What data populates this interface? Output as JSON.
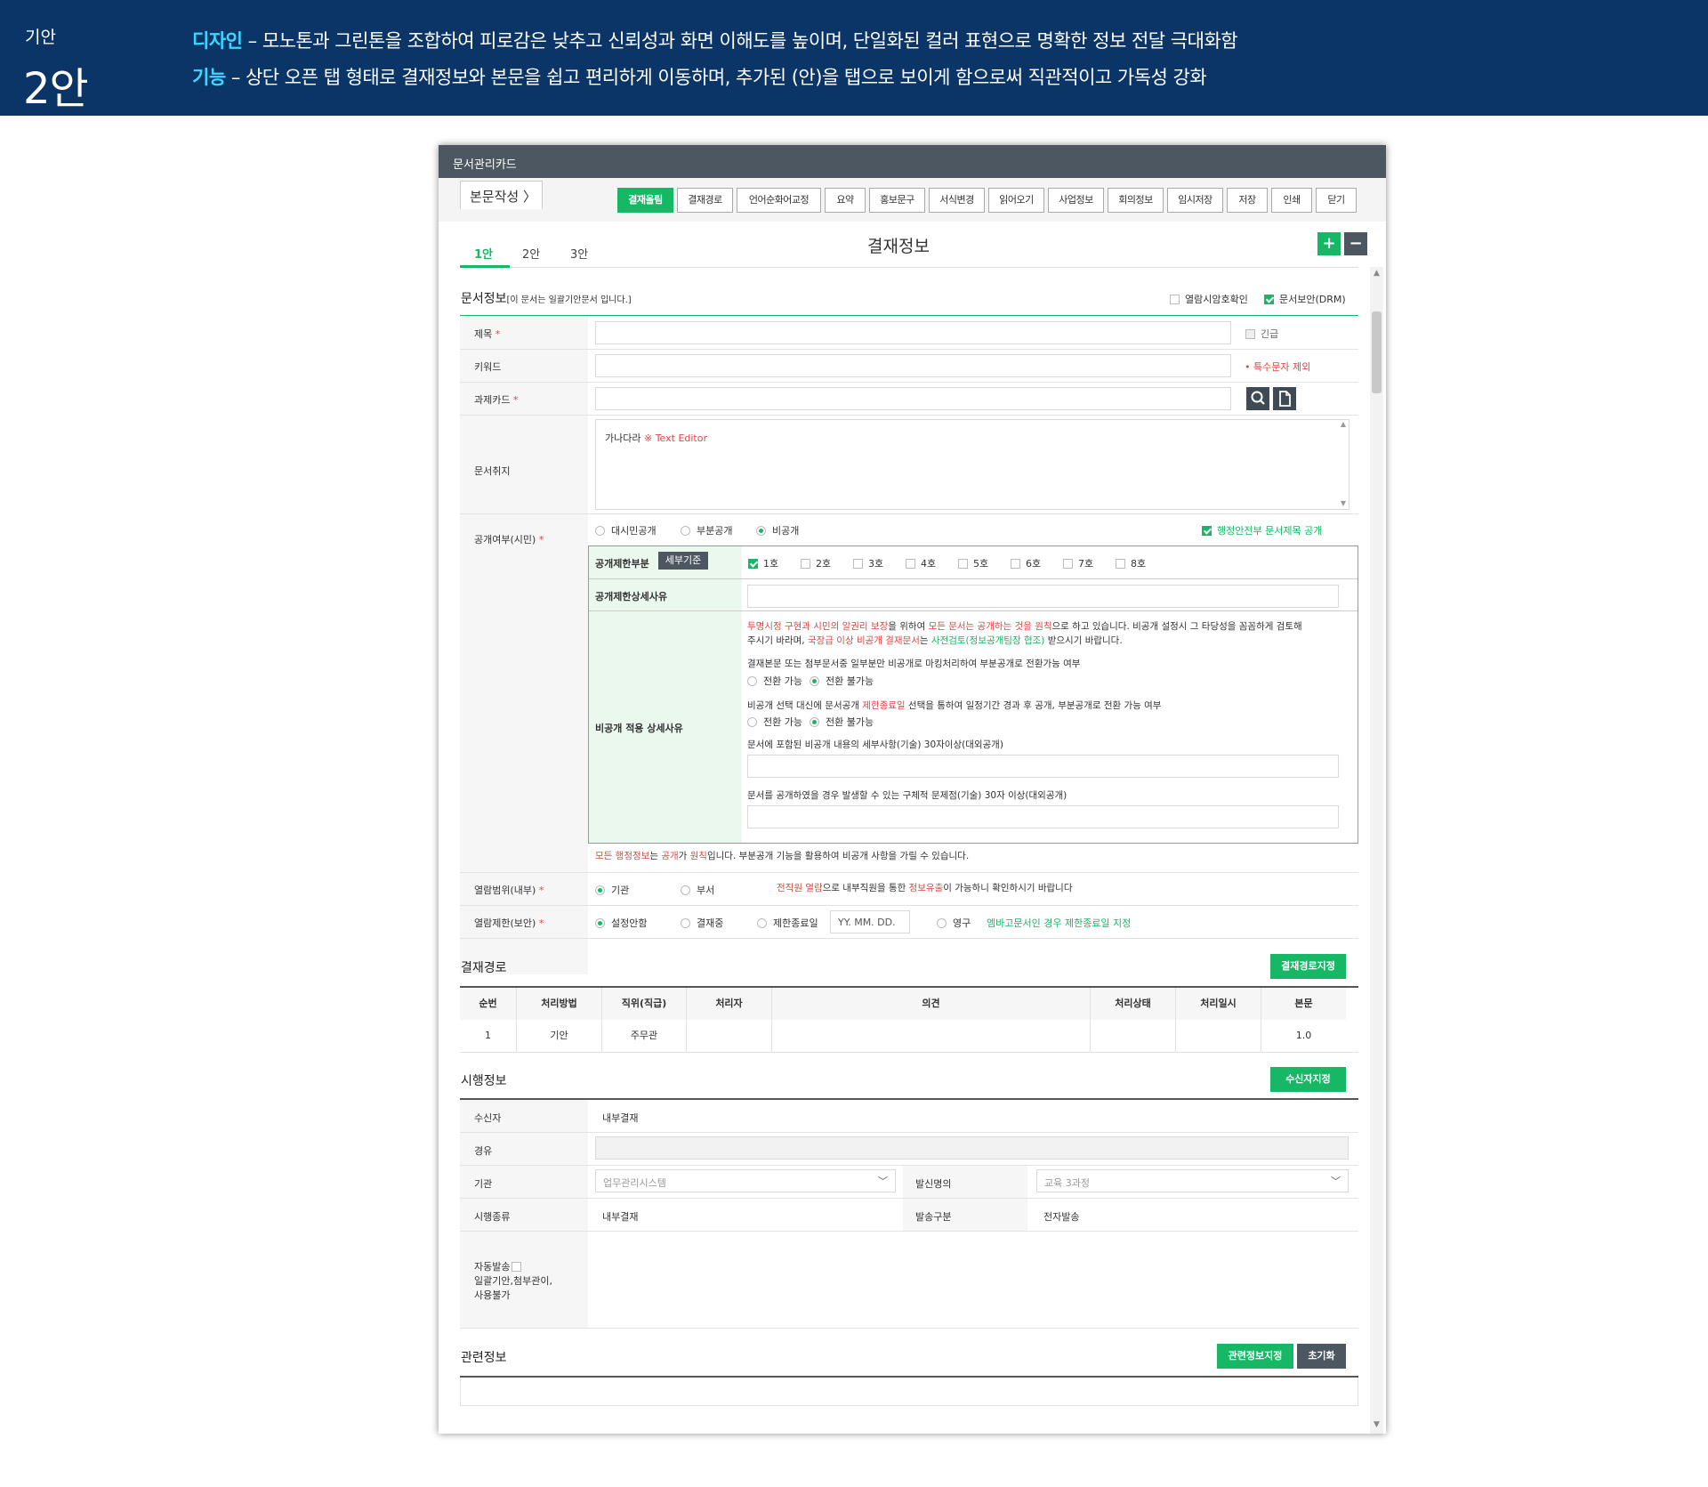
{
  "banner": {
    "kian": "기안",
    "num": "2안",
    "line1_key": "디자인",
    "line1_text": " – 모노톤과 그린톤을 조합하여 피로감은 낮추고 신뢰성과 화면 이해도를 높이며, 단일화된 컬러 표현으로 명확한 정보 전달 극대화함",
    "line2_key": "기능",
    "line2_text": " – 상단 오픈 탭 형태로 결재정보와 본문을 쉽고 편리하게 이동하며, 추가된 (안)을 탭으로 보이게 함으로써 직관적이고 가독성 강화"
  },
  "window": {
    "title": "문서관리카드",
    "body_tab": "본문작성 〉",
    "toolbar": [
      "결재올림",
      "결재경로",
      "언어순화어교정",
      "요약",
      "홍보문구",
      "서식변경",
      "읽어오기",
      "사업정보",
      "회의정보",
      "임시저장",
      "저장",
      "인쇄",
      "닫기"
    ],
    "page_title": "결재정보",
    "plus": "+",
    "minus": "−",
    "tabs": [
      "1안",
      "2안",
      "3안"
    ]
  },
  "docinfo": {
    "title": "문서정보",
    "sub": "[이 문서는 일괄기안문서 입니다.]",
    "cb_verify": "열람시암호확인",
    "cb_drm": "문서보안(DRM)",
    "f_title": "제목",
    "star": "*",
    "urgent": "긴급",
    "f_keyword": "키워드",
    "kw_note": "• 특수문자 제외",
    "f_taskcard": "과제카드",
    "f_purpose": "문서취지",
    "editor_text": "가나다라",
    "editor_hint": "※ Text Editor",
    "f_public": "공개여부(시민)",
    "r_public": "대시민공개",
    "r_partial": "부분공개",
    "r_private": "비공개",
    "cb_gov": "행정안전부 문서제목 공개",
    "limit_part": "공개제한부분",
    "detail_btn": "세부기준",
    "numbers": [
      "1호",
      "2호",
      "3호",
      "4호",
      "5호",
      "6호",
      "7호",
      "8호"
    ],
    "limit_reason": "공개제한상세사유",
    "private_detail": "비공개 적용 상세사유",
    "p1_a": "투명시정 구현과 시민의 알권리 보장",
    "p1_b": "을 위하여 ",
    "p1_c": "모든 문서는 공개하는 것을 원칙",
    "p1_d": "으로 하고 있습니다. 비공개 설정시 그 타당성을 꼼꼼하게 검토해",
    "p2_a": "주시기 바라며, ",
    "p2_b": "국장급 이상 비공개 결재문서",
    "p2_c": "는 ",
    "p2_d": "사전검토(정보공개팀장 협조)",
    "p2_e": " 받으시기 바랍니다.",
    "q1": "결재본문 또는 첨부문서중 일부분만 비공개로 마킹처리하여 부분공개로 전환가능 여부",
    "yes": "전환 가능",
    "no": "전환 불가능",
    "q2_a": "비공개 선택 대신에 문서공개 ",
    "q2_b": "제한종료일",
    "q2_c": " 선택을 통하여 일정기간 경과 후 공개, 부분공개로 전환 가능 여부",
    "q3": "문서에 포함된 비공개 내용의 세부사항(기술) 30자이상(대외공개)",
    "q4": "문서를 공개하였을 경우 발생할 수 있는 구체적 문제점(기술) 30자 이상(대외공개)",
    "bottom_a": "모든 행정정보",
    "bottom_b": "는 ",
    "bottom_c": "공개",
    "bottom_d": "가 ",
    "bottom_e": "원칙",
    "bottom_f": "입니다. 부분공개 기능을 활용하여 비공개 사항을 가릴 수 있습니다.",
    "f_scope": "열람범위(내부)",
    "r_org": "기관",
    "r_dept": "부서",
    "scope_a": "전직원 열람",
    "scope_b": "으로 내부직원을 통한 ",
    "scope_c": "정보유출",
    "scope_d": "이 가능하니 확인하시기 바랍니다",
    "f_limit": "열람제한(보안)",
    "r_none": "설정안함",
    "r_during": "결재중",
    "r_enddate": "제한종료일",
    "date_ph": "YY.  MM.  DD.",
    "r_forever": "영구",
    "limit_note": "엠바고문서인 경우 제한종료일 지정"
  },
  "route": {
    "title": "결재경로",
    "btn": "결재경로지정",
    "headers": [
      "순번",
      "처리방법",
      "직위(직급)",
      "처리자",
      "의견",
      "처리상태",
      "처리일시",
      "본문"
    ],
    "row": [
      "1",
      "기안",
      "주무관",
      "",
      "",
      "",
      "",
      "1.0"
    ]
  },
  "exec": {
    "title": "시행정보",
    "btn": "수신자지정",
    "receiver_l": "수신자",
    "receiver_v": "내부결재",
    "via_l": "경유",
    "org_l": "기관",
    "org_v": "업무관리시스템",
    "sender_l": "발신명의",
    "sender_v": "교육 3과정",
    "type_l": "시행종류",
    "type_v": "내부결재",
    "send_l": "발송구분",
    "send_v": "전자발송",
    "auto_1": "자동발송",
    "auto_2": "일괄기안,첨부관이,",
    "auto_3": "사용불가"
  },
  "related": {
    "title": "관련정보",
    "btn1": "관련정보지정",
    "btn2": "초기화"
  }
}
